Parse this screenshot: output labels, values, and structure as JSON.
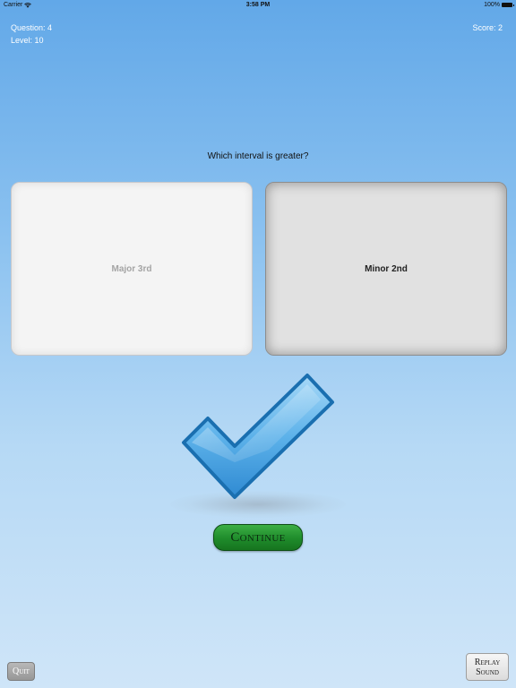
{
  "status_bar": {
    "carrier": "Carrier",
    "time": "3:58 PM",
    "battery": "100%",
    "wifi_icon": "wifi-icon",
    "battery_icon": "battery-icon"
  },
  "header": {
    "question": "Question: 4",
    "level": "Level: 10",
    "score": "Score: 2"
  },
  "prompt": "Which interval is greater?",
  "answers": [
    {
      "label": "Major 3rd",
      "state": "unselected"
    },
    {
      "label": "Minor 2nd",
      "state": "selected"
    }
  ],
  "feedback": {
    "icon": "checkmark-icon",
    "colors": {
      "fill": "#5db2ea",
      "outline": "#1a6fb0"
    }
  },
  "buttons": {
    "continue": "Continue",
    "quit": "Quit",
    "replay_line1": "Replay",
    "replay_line2": "Sound"
  },
  "colors": {
    "background_top": "#62a8e8",
    "background_bottom": "#cfe5f8",
    "continue_green": "#1f8b2b"
  }
}
